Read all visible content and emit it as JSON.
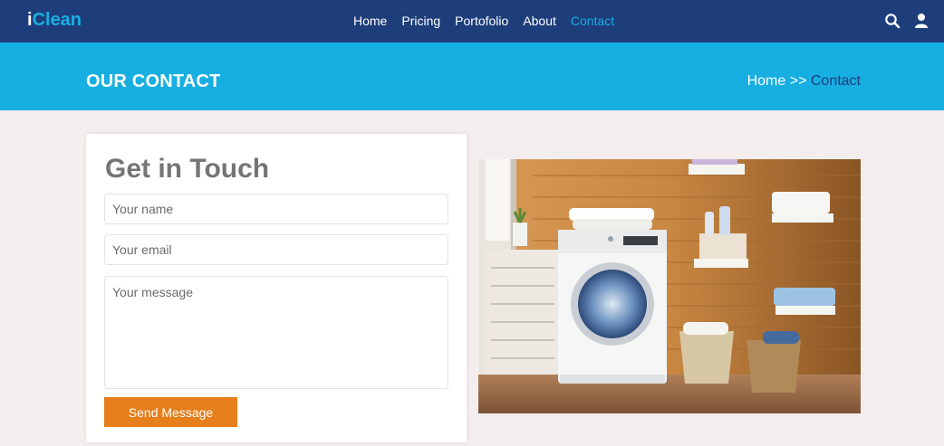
{
  "navbar": {
    "logo_first": "i",
    "logo_rest": "Clean",
    "links": [
      "Home",
      "Pricing",
      "Portofolio",
      "About",
      "Contact"
    ],
    "active_link": "Contact",
    "icons": [
      "search-icon",
      "user-icon"
    ],
    "background_color": "#1d3e7a",
    "accent_color": "#18aee3"
  },
  "banner": {
    "title": "OUR CONTACT",
    "breadcrumb_home": "Home >>",
    "breadcrumb_current": "Contact",
    "background_color": "#17aee2"
  },
  "contact_form": {
    "title": "Get in Touch",
    "name_placeholder": "Your name",
    "email_placeholder": "Your email",
    "message_placeholder": "Your message",
    "submit_label": "Send Message",
    "submit_color": "#e57e1b"
  },
  "image": {
    "icon": "laundry-room-photo"
  }
}
